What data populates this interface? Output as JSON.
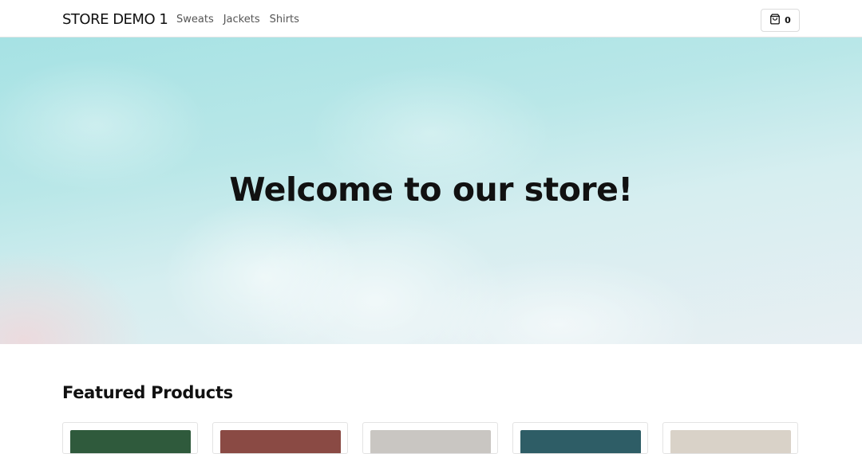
{
  "nav": {
    "brand": "STORE DEMO 1",
    "links": [
      {
        "label": "Sweats"
      },
      {
        "label": "Jackets"
      },
      {
        "label": "Shirts"
      }
    ],
    "cart": {
      "count": "0",
      "icon": "shopping-bag-icon"
    }
  },
  "hero": {
    "title": "Welcome to our store!"
  },
  "featured": {
    "title": "Featured Products",
    "products": [
      {
        "thumb_color": "#2f5a3c"
      },
      {
        "thumb_color": "#8a4a44"
      },
      {
        "thumb_color": "#c9c6c2"
      },
      {
        "thumb_color": "#2e5d66"
      },
      {
        "thumb_color": "#d9d2c8"
      }
    ]
  }
}
